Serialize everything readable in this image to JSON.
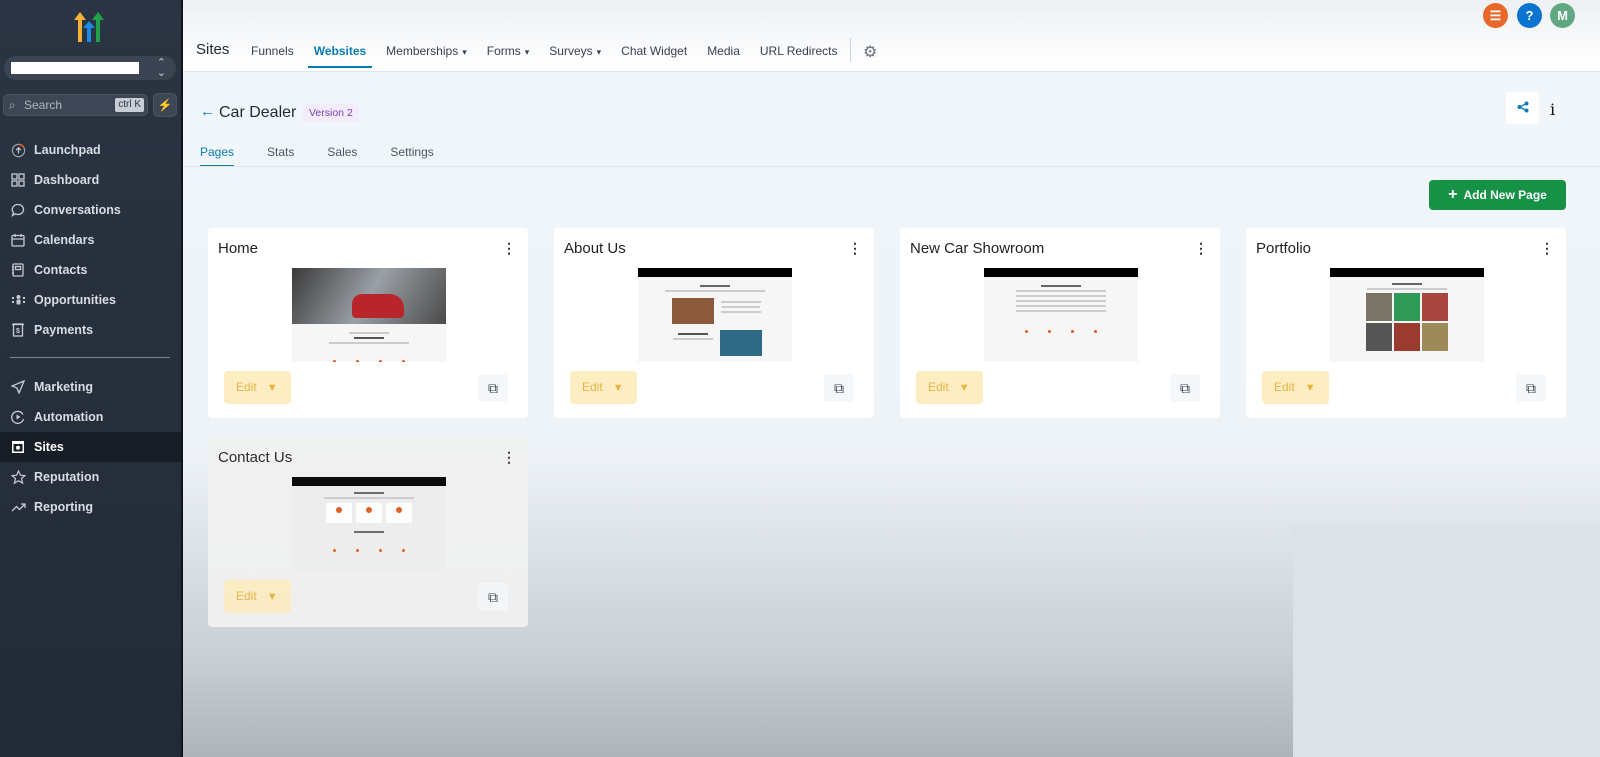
{
  "sidebar": {
    "search_placeholder": "Search",
    "search_shortcut": "ctrl K",
    "items_top": [
      {
        "label": "Launchpad",
        "icon": "launchpad-icon"
      },
      {
        "label": "Dashboard",
        "icon": "dashboard-icon"
      },
      {
        "label": "Conversations",
        "icon": "chat-bubble-icon"
      },
      {
        "label": "Calendars",
        "icon": "calendar-icon"
      },
      {
        "label": "Contacts",
        "icon": "contacts-icon"
      },
      {
        "label": "Opportunities",
        "icon": "opportunities-icon"
      },
      {
        "label": "Payments",
        "icon": "payments-icon"
      }
    ],
    "items_bottom": [
      {
        "label": "Marketing",
        "icon": "send-icon"
      },
      {
        "label": "Automation",
        "icon": "automation-icon"
      },
      {
        "label": "Sites",
        "icon": "sites-icon",
        "active": true
      },
      {
        "label": "Reputation",
        "icon": "star-icon"
      },
      {
        "label": "Reporting",
        "icon": "trend-icon"
      }
    ]
  },
  "topbar": {
    "section": "Sites",
    "tabs": [
      {
        "label": "Funnels"
      },
      {
        "label": "Websites",
        "active": true
      },
      {
        "label": "Memberships",
        "dropdown": true
      },
      {
        "label": "Forms",
        "dropdown": true
      },
      {
        "label": "Surveys",
        "dropdown": true
      },
      {
        "label": "Chat Widget"
      },
      {
        "label": "Media"
      },
      {
        "label": "URL Redirects"
      }
    ],
    "avatar_initial": "M",
    "colors": {
      "list": "#e8672a",
      "help": "#0b74d1",
      "avatar": "#5fa882"
    }
  },
  "page": {
    "title": "Car Dealer",
    "version_badge": "Version 2",
    "subtabs": [
      "Pages",
      "Stats",
      "Sales",
      "Settings"
    ],
    "active_subtab": "Pages",
    "add_button": "Add New Page"
  },
  "cards": [
    {
      "title": "Home",
      "edit": "Edit"
    },
    {
      "title": "About Us",
      "edit": "Edit"
    },
    {
      "title": "New Car Showroom",
      "edit": "Edit"
    },
    {
      "title": "Portfolio",
      "edit": "Edit"
    },
    {
      "title": "Contact Us",
      "edit": "Edit"
    }
  ],
  "colors": {
    "accent": "#0a7bb3",
    "add_button": "#169247",
    "edit_button_bg": "#fdedc3",
    "sidebar_bg": "#2b3442"
  }
}
